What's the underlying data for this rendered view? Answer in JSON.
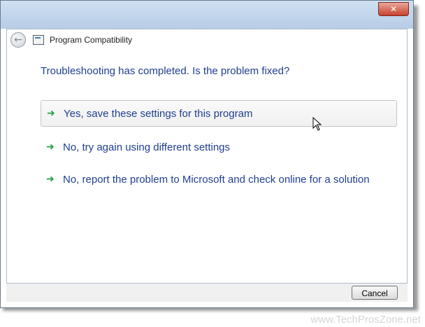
{
  "window": {
    "title": "Program Compatibility",
    "close_label": "✕"
  },
  "heading": "Troubleshooting has completed.  Is the problem fixed?",
  "options": [
    {
      "label": "Yes, save these settings for this program",
      "icon": "green-arrow-icon"
    },
    {
      "label": "No, try again using different settings",
      "icon": "green-arrow-icon"
    },
    {
      "label": "No, report the problem to Microsoft and check online for a solution",
      "icon": "green-arrow-icon"
    }
  ],
  "footer": {
    "cancel_label": "Cancel"
  },
  "watermark": "www.TechProsZone.net",
  "colors": {
    "link_blue": "#1e3f8f",
    "arrow_green": "#1fa33a"
  }
}
